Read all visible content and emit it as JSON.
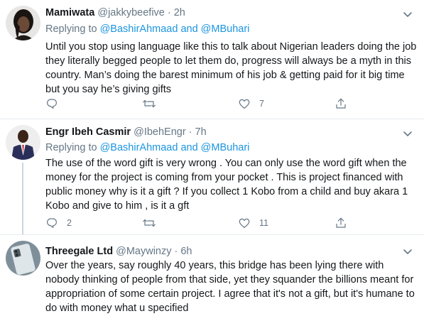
{
  "reply_label": "Replying to",
  "mention_1": "@BashirAhmaad",
  "and_word": "and",
  "mention_2": "@MBuhari",
  "tweets": [
    {
      "name": "Mamiwata",
      "handle": "@jakkybeefive",
      "time": "· 2h",
      "text": "Until you stop using language like this to talk about Nigerian leaders doing the job they literally begged people to let them do, progress will always be a myth in this country. Man’s doing the barest minimum of his job & getting paid for it big time but you say he’s giving gifts",
      "reply_count": "",
      "retweet_count": "",
      "like_count": "7"
    },
    {
      "name": "Engr Ibeh Casmir",
      "handle": "@IbehEngr",
      "time": "· 7h",
      "text": "The use of the word gift is very wrong . You can only use the word gift when the money for the project is coming from your pocket . This is project financed with public money why is it a gift ?  If you collect 1 Kobo from a child and buy akara 1 Kobo and give to him , is it a gft",
      "reply_count": "2",
      "retweet_count": "",
      "like_count": "11"
    },
    {
      "name": "Threegale Ltd",
      "handle": "@Maywinzy",
      "time": "· 6h",
      "text": "Over the years, say roughly 40 years, this bridge has been lying there with nobody thinking of people from that side, yet they squander the billions meant for appropriation of some certain project. I agree that it's not a gift, but it's humane to do with money what u specified",
      "reply_count": "",
      "retweet_count": "",
      "like_count": ""
    }
  ],
  "colors": {
    "accent": "#1b95e0",
    "muted": "#657786",
    "divider": "#e6ecf0",
    "thread_line": "#ccd6dd"
  },
  "icons": [
    "chevron-down-icon",
    "reply-icon",
    "retweet-icon",
    "like-icon",
    "share-icon"
  ]
}
